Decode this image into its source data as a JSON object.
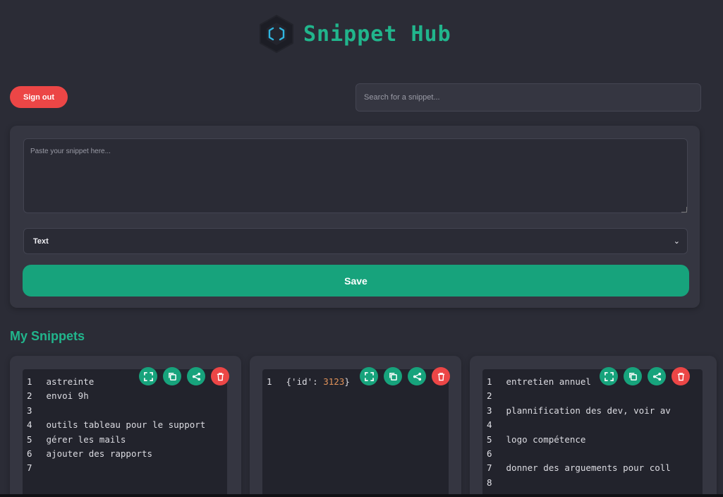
{
  "app": {
    "title": "Snippet Hub",
    "brand_color": "#21b58c",
    "logo_icon": "hexagon-code-icon"
  },
  "header": {
    "sign_out_label": "Sign out",
    "search_placeholder": "Search for a snippet..."
  },
  "composer": {
    "textarea_placeholder": "Paste your snippet here...",
    "language_selected": "Text",
    "save_label": "Save"
  },
  "snippets_section": {
    "title": "My Snippets",
    "cards": [
      {
        "lines": [
          {
            "n": "1",
            "text": "astreinte"
          },
          {
            "n": "2",
            "text": "envoi 9h"
          },
          {
            "n": "3",
            "text": ""
          },
          {
            "n": "4",
            "text": "outils tableau pour le support"
          },
          {
            "n": "5",
            "text": "gérer les mails"
          },
          {
            "n": "6",
            "text": "ajouter des rapports"
          },
          {
            "n": "7",
            "text": ""
          }
        ]
      },
      {
        "lines": [
          {
            "n": "1",
            "text_pre": "{'id': ",
            "number": "3123",
            "text_post": "}"
          }
        ]
      },
      {
        "lines": [
          {
            "n": "1",
            "text": "entretien annuel"
          },
          {
            "n": "2",
            "text": ""
          },
          {
            "n": "3",
            "text": "plannification des dev, voir av"
          },
          {
            "n": "4",
            "text": ""
          },
          {
            "n": "5",
            "text": "logo compétence"
          },
          {
            "n": "6",
            "text": ""
          },
          {
            "n": "7",
            "text": "donner des arguements pour coll"
          },
          {
            "n": "8",
            "text": ""
          }
        ]
      }
    ],
    "card_actions": [
      "expand-icon",
      "copy-icon",
      "share-icon",
      "delete-icon"
    ]
  },
  "colors": {
    "background": "#2b2c36",
    "panel": "#353641",
    "accent_green": "#17a37c",
    "danger_red": "#ec4646",
    "code_number": "#e2935a"
  }
}
